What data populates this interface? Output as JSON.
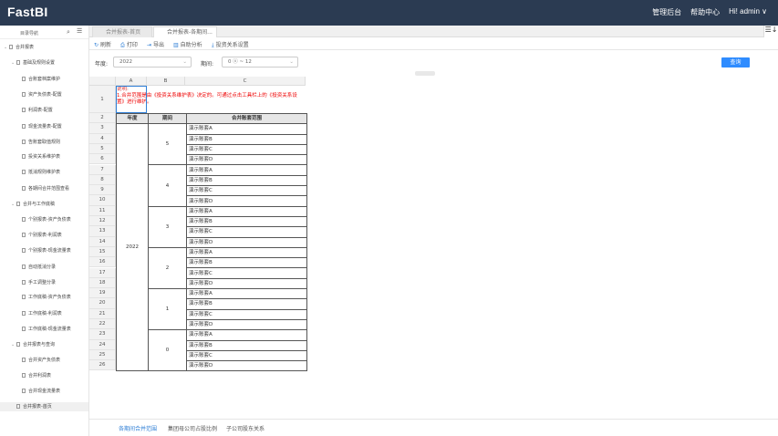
{
  "app": {
    "logo": "FastBI"
  },
  "topnav": {
    "admin": "管理后台",
    "help": "帮助中心",
    "user": "Hi! admin ∨"
  },
  "sidebar": {
    "title": "目录导航",
    "search_icon": "⌕",
    "menu_icon": "☰",
    "items": [
      {
        "label": "合并报表",
        "level": 0,
        "arrow": "⌄"
      },
      {
        "label": "基础及规则设置",
        "level": 1,
        "arrow": "⌄"
      },
      {
        "label": "合账套档案维护",
        "level": 2
      },
      {
        "label": "资产负债表-配置",
        "level": 2
      },
      {
        "label": "利润表-配置",
        "level": 2
      },
      {
        "label": "现金流量表-配置",
        "level": 2
      },
      {
        "label": "告账套取值规则",
        "level": 2
      },
      {
        "label": "投资关系维护表",
        "level": 2
      },
      {
        "label": "抵消规则维护表",
        "level": 2
      },
      {
        "label": "各期间合并范围查看",
        "level": 2
      },
      {
        "label": "合并与工作底稿",
        "level": 1,
        "arrow": "⌄"
      },
      {
        "label": "个别报表-资产负债表",
        "level": 2
      },
      {
        "label": "个别报表-利润表",
        "level": 2
      },
      {
        "label": "个别报表-现金流量表",
        "level": 2
      },
      {
        "label": "自动抵消分录",
        "level": 2
      },
      {
        "label": "手工调整分录",
        "level": 2
      },
      {
        "label": "工作底稿-资产负债表",
        "level": 2
      },
      {
        "label": "工作底稿-利润表",
        "level": 2
      },
      {
        "label": "工作底稿-现金流量表",
        "level": 2
      },
      {
        "label": "合并报表与查询",
        "level": 1,
        "arrow": "⌄"
      },
      {
        "label": "合并资产负债表",
        "level": 2
      },
      {
        "label": "合并利润表",
        "level": 2
      },
      {
        "label": "合并现金流量表",
        "level": 2
      },
      {
        "label": "合并报表-首页",
        "level": 1
      }
    ]
  },
  "tabs": [
    {
      "label": "合并报表-首页"
    },
    {
      "label": "合并报表-各期间..."
    }
  ],
  "tab_menu_icon": "☰↓",
  "toolbar": {
    "refresh": "刷新",
    "print": "打印",
    "export": "导出",
    "analysis": "自助分析",
    "invest": "投资关系设置"
  },
  "params": {
    "year_label": "年度:",
    "year_value": "2022",
    "period_label": "期间:",
    "period_value": "0 ⓧ  ~ 12",
    "query": "查询"
  },
  "grid": {
    "cols": [
      "A",
      "B",
      "C"
    ],
    "rows": [
      "1",
      "2",
      "3",
      "4",
      "5",
      "6",
      "7",
      "8",
      "9",
      "10",
      "11",
      "12",
      "13",
      "14",
      "15",
      "16",
      "17",
      "18",
      "19",
      "20",
      "21",
      "22",
      "23",
      "24",
      "25",
      "26"
    ],
    "note_title": "说明:",
    "note_text": "1.合并范围是由《投资关系维护表》决定的。可通过点击工具栏上的《投资关系设置》进行维护。",
    "headers": [
      "年度",
      "期间",
      "合并账套范围"
    ],
    "year": "2022",
    "periods": [
      "5",
      "4",
      "3",
      "2",
      "1",
      "0"
    ],
    "accounts": [
      "演示账套A",
      "演示账套B",
      "演示账套C",
      "演示账套D"
    ]
  },
  "bottom_tabs": [
    "各期间合并范围",
    "集团母公司占股比例",
    "子公司股东关系"
  ]
}
